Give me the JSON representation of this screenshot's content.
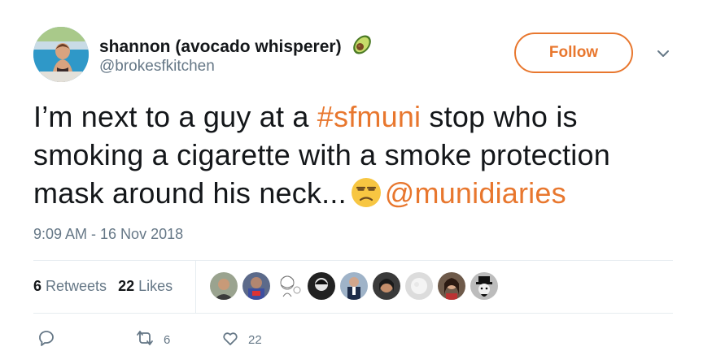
{
  "author": {
    "display_name": "shannon (avocado whisperer)",
    "handle": "@brokesfkitchen",
    "name_emoji": "avocado-icon"
  },
  "follow_button": {
    "label": "Follow"
  },
  "tweet": {
    "text_part1": "I’m next to a guy at a ",
    "hashtag": "#sfmuni",
    "text_part2": " stop who is smoking a cigarette with a smoke protection mask around his neck...",
    "emoji": "unamused-face-icon",
    "mention": "@munidiaries",
    "timestamp": "9:09 AM - 16 Nov 2018"
  },
  "stats": {
    "retweets_count": "6",
    "retweets_label": "Retweets",
    "likes_count": "22",
    "likes_label": "Likes"
  },
  "likers_count_shown": 9,
  "actions": {
    "reply_icon": "reply-icon",
    "retweet_icon": "retweet-icon",
    "retweet_count": "6",
    "like_icon": "heart-icon",
    "like_count": "22"
  },
  "colors": {
    "accent": "#e8772e",
    "text": "#14171a",
    "secondary": "#657786",
    "divider": "#e6ecf0"
  }
}
